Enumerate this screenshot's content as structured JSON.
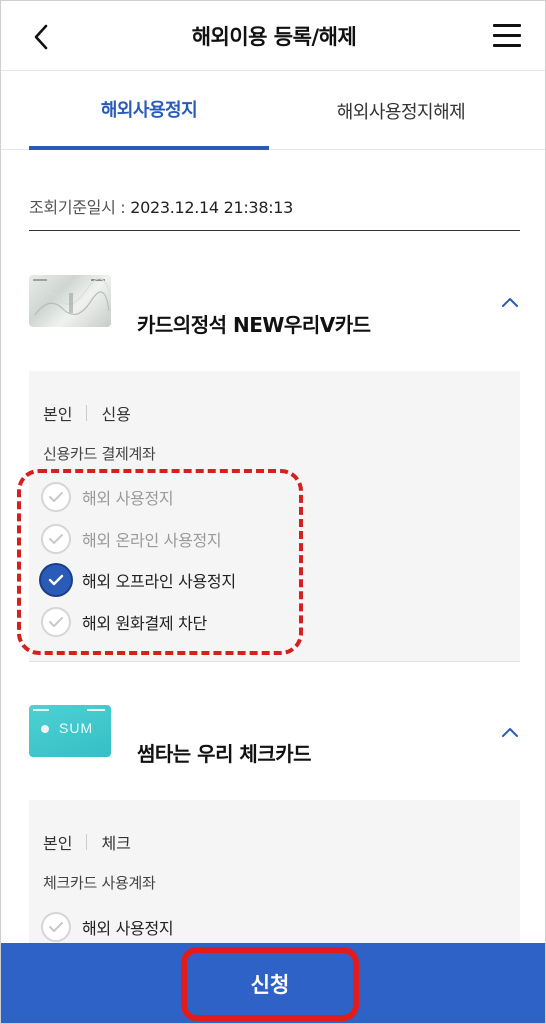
{
  "header": {
    "title": "해외이용 등록/해제",
    "back_icon": "chevron-left-icon",
    "menu_icon": "hamburger-menu-icon"
  },
  "tabs": [
    {
      "label": "해외사용정지",
      "active": true
    },
    {
      "label": "해외사용정지해제",
      "active": false
    }
  ],
  "query": {
    "label": "조회기준일시 : ",
    "value": "2023.12.14 21:38:13"
  },
  "cards": [
    {
      "name": "카드의정석 NEW우리V카드",
      "owner": "본인",
      "type": "신용",
      "account_label": "신용카드 결제계좌",
      "options": [
        {
          "label": "해외 사용정지",
          "checked": false,
          "disabled": true
        },
        {
          "label": "해외 온라인 사용정지",
          "checked": false,
          "disabled": true
        },
        {
          "label": "해외 오프라인 사용정지",
          "checked": true,
          "disabled": false
        },
        {
          "label": "해외 원화결제 차단",
          "checked": false,
          "disabled": false
        }
      ]
    },
    {
      "name": "썸타는 우리 체크카드",
      "card_logo_text": "SUM",
      "owner": "본인",
      "type": "체크",
      "account_label": "체크카드 사용계좌",
      "options": [
        {
          "label": "해외 사용정지",
          "checked": false,
          "disabled": false
        }
      ]
    }
  ],
  "footer": {
    "apply_label": "신청"
  },
  "colors": {
    "accent": "#2a5bb8",
    "footer": "#2f62c7",
    "highlight": "#d61f1f"
  }
}
